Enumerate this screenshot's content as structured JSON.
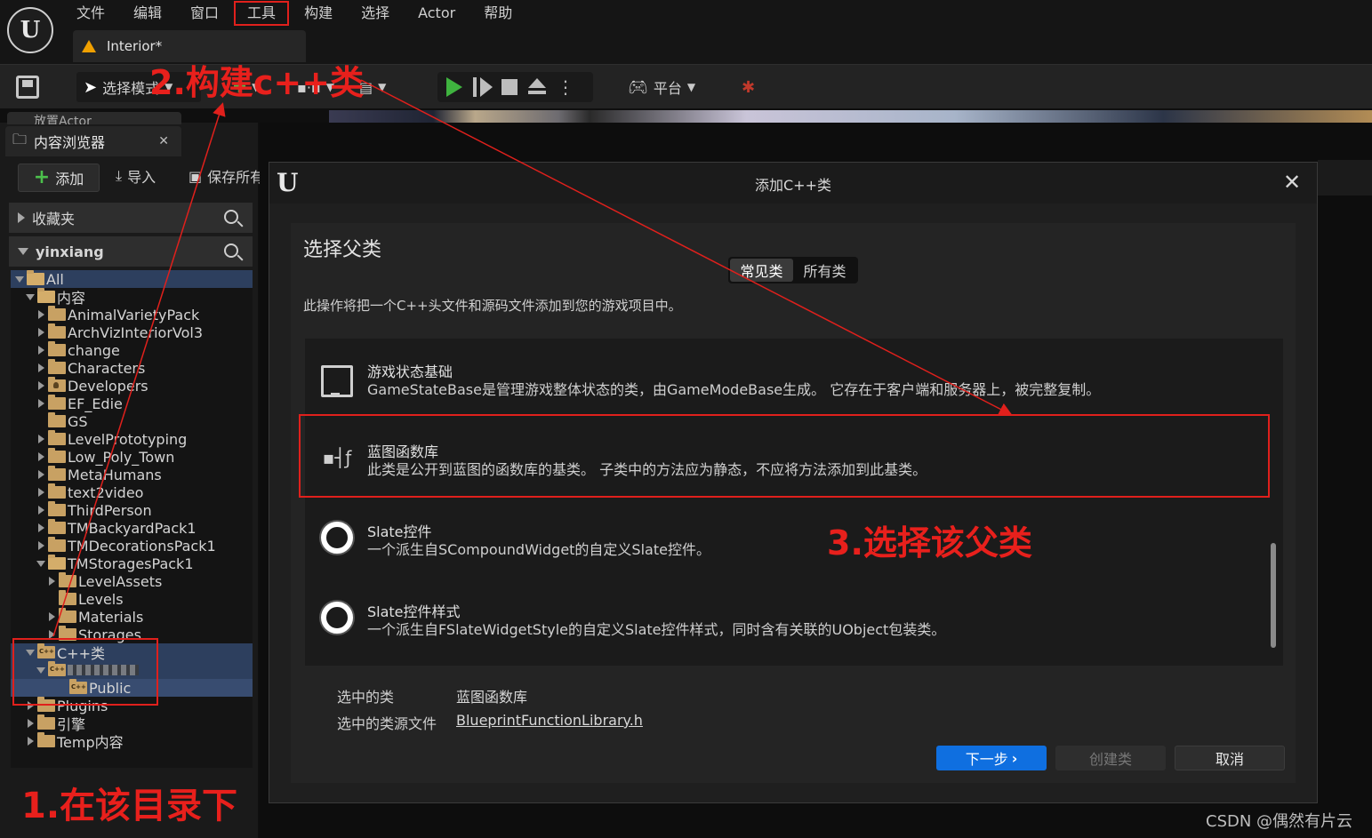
{
  "app": {
    "doc_tab": "Interior*"
  },
  "menu": [
    "文件",
    "编辑",
    "窗口",
    "工具",
    "构建",
    "选择",
    "Actor",
    "帮助"
  ],
  "toolbar": {
    "select_mode": "选择模式",
    "platform": "平台"
  },
  "left": {
    "place_actor_tab": "放置Actor",
    "content_browser_tab": "内容浏览器",
    "add": "添加",
    "import": "导入",
    "save_all": "保存所有",
    "favorites": "收藏夹",
    "project": "yinxiang"
  },
  "tree": [
    {
      "label": "All",
      "depth": 0,
      "exp": "down",
      "icon": "open",
      "sel": "sel"
    },
    {
      "label": "内容",
      "depth": 1,
      "exp": "down",
      "icon": "open"
    },
    {
      "label": "AnimalVarietyPack",
      "depth": 2,
      "exp": "right",
      "icon": "folder"
    },
    {
      "label": "ArchVizInteriorVol3",
      "depth": 2,
      "exp": "right",
      "icon": "folder"
    },
    {
      "label": "change",
      "depth": 2,
      "exp": "right",
      "icon": "folder"
    },
    {
      "label": "Characters",
      "depth": 2,
      "exp": "right",
      "icon": "folder"
    },
    {
      "label": "Developers",
      "depth": 2,
      "exp": "right",
      "icon": "dev"
    },
    {
      "label": "EF_Edie",
      "depth": 2,
      "exp": "right",
      "icon": "folder"
    },
    {
      "label": "GS",
      "depth": 2,
      "exp": "none",
      "icon": "folder"
    },
    {
      "label": "LevelPrototyping",
      "depth": 2,
      "exp": "right",
      "icon": "folder"
    },
    {
      "label": "Low_Poly_Town",
      "depth": 2,
      "exp": "right",
      "icon": "folder"
    },
    {
      "label": "MetaHumans",
      "depth": 2,
      "exp": "right",
      "icon": "folder"
    },
    {
      "label": "text2video",
      "depth": 2,
      "exp": "right",
      "icon": "folder"
    },
    {
      "label": "ThirdPerson",
      "depth": 2,
      "exp": "right",
      "icon": "folder"
    },
    {
      "label": "TMBackyardPack1",
      "depth": 2,
      "exp": "right",
      "icon": "folder"
    },
    {
      "label": "TMDecorationsPack1",
      "depth": 2,
      "exp": "right",
      "icon": "folder"
    },
    {
      "label": "TMStoragesPack1",
      "depth": 2,
      "exp": "down",
      "icon": "open"
    },
    {
      "label": "LevelAssets",
      "depth": 3,
      "exp": "right",
      "icon": "folder"
    },
    {
      "label": "Levels",
      "depth": 3,
      "exp": "none",
      "icon": "folder"
    },
    {
      "label": "Materials",
      "depth": 3,
      "exp": "right",
      "icon": "folder"
    },
    {
      "label": "Storages",
      "depth": 3,
      "exp": "right",
      "icon": "folder"
    },
    {
      "label": "C++类",
      "depth": 1,
      "exp": "down",
      "icon": "cpp",
      "sel": "sel"
    },
    {
      "label": "",
      "depth": 2,
      "exp": "down",
      "icon": "cpp",
      "sel": "sel",
      "blur": true
    },
    {
      "label": "Public",
      "depth": 4,
      "exp": "none",
      "icon": "cpp",
      "sel": "sel2"
    },
    {
      "label": "Plugins",
      "depth": 1,
      "exp": "right",
      "icon": "folder"
    },
    {
      "label": "引擎",
      "depth": 1,
      "exp": "right",
      "icon": "folder"
    },
    {
      "label": "Temp内容",
      "depth": 1,
      "exp": "right",
      "icon": "folder"
    }
  ],
  "dialog": {
    "title": "添加C++类",
    "heading": "选择父类",
    "tabs": [
      "常见类",
      "所有类"
    ],
    "description": "此操作将把一个C++头文件和源码文件添加到您的游戏项目中。",
    "classes": [
      {
        "name": "游戏状态基础",
        "desc": "GameStateBase是管理游戏整体状态的类，由GameModeBase生成。 它存在于客户端和服务器上，被完整复制。",
        "icon": "monitor-icon"
      },
      {
        "name": "蓝图函数库",
        "desc": "此类是公开到蓝图的函数库的基类。 子类中的方法应为静态，不应将方法添加到此基类。",
        "icon": "blueprint-library-icon"
      },
      {
        "name": "Slate控件",
        "desc": "一个派生自SCompoundWidget的自定义Slate控件。",
        "icon": "ring-icon"
      },
      {
        "name": "Slate控件样式",
        "desc": "一个派生自FSlateWidgetStyle的自定义Slate控件样式，同时含有关联的UObject包装类。",
        "icon": "ring-icon"
      }
    ],
    "selected_class_label": "选中的类",
    "selected_class_value": "蓝图函数库",
    "selected_source_label": "选中的类源文件",
    "selected_source_value": "BlueprintFunctionLibrary.h",
    "next": "下一步",
    "create": "创建类",
    "cancel": "取消"
  },
  "annotations": {
    "step1": "1.在该目录下",
    "step2": "2.构建c++类",
    "step3": "3.选择该父类",
    "color": "#e0201c"
  },
  "watermark": "CSDN @偶然有片云"
}
